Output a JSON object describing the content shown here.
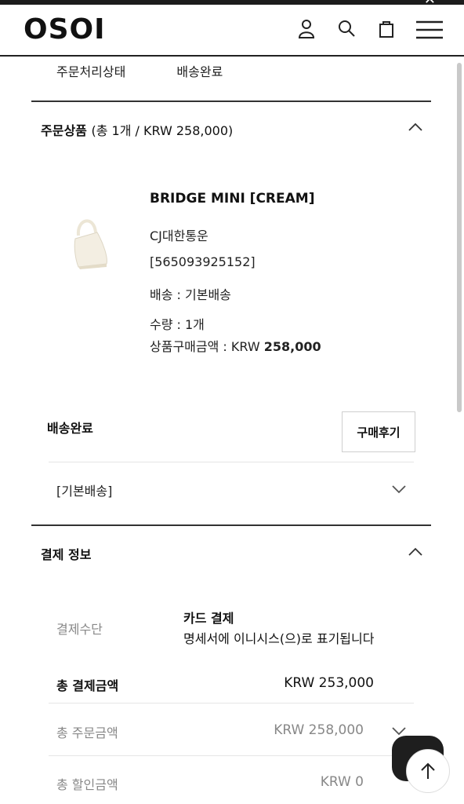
{
  "header": {
    "logo": "OSOI",
    "icons": [
      "user-icon",
      "search-icon",
      "bag-icon",
      "menu-icon"
    ]
  },
  "order_status": {
    "label": "주문처리상태",
    "value": "배송완료"
  },
  "products_section": {
    "title": "주문상품",
    "summary": "(총 1개 / KRW 258,000)",
    "item": {
      "name": "BRIDGE MINI [CREAM]",
      "carrier": "CJ대한통운",
      "tracking": "[565093925152]",
      "shipping": "배송 : 기본배송",
      "quantity": "수량 : 1개",
      "price_label": "상품구매금액 : KRW ",
      "price_value": "258,000"
    },
    "delivery_status": "배송완료",
    "review_button": "구매후기",
    "shipping_group": "[기본배송]"
  },
  "payment_section": {
    "title": "결제 정보",
    "method_label": "결제수단",
    "method_value": "카드 결제",
    "method_note": "명세서에 이니시스(으)로 표기됩니다",
    "total_payment_label": "총 결제금액",
    "total_payment_value": "KRW 253,000",
    "total_order_label": "총 주문금액",
    "total_order_value": "KRW 258,000",
    "total_discount_label": "총 할인금액",
    "total_discount_value": "KRW 0"
  },
  "colors": {
    "text": "#111111",
    "muted": "#888888",
    "divider": "#333333",
    "light_divider": "#e5e5e5"
  }
}
